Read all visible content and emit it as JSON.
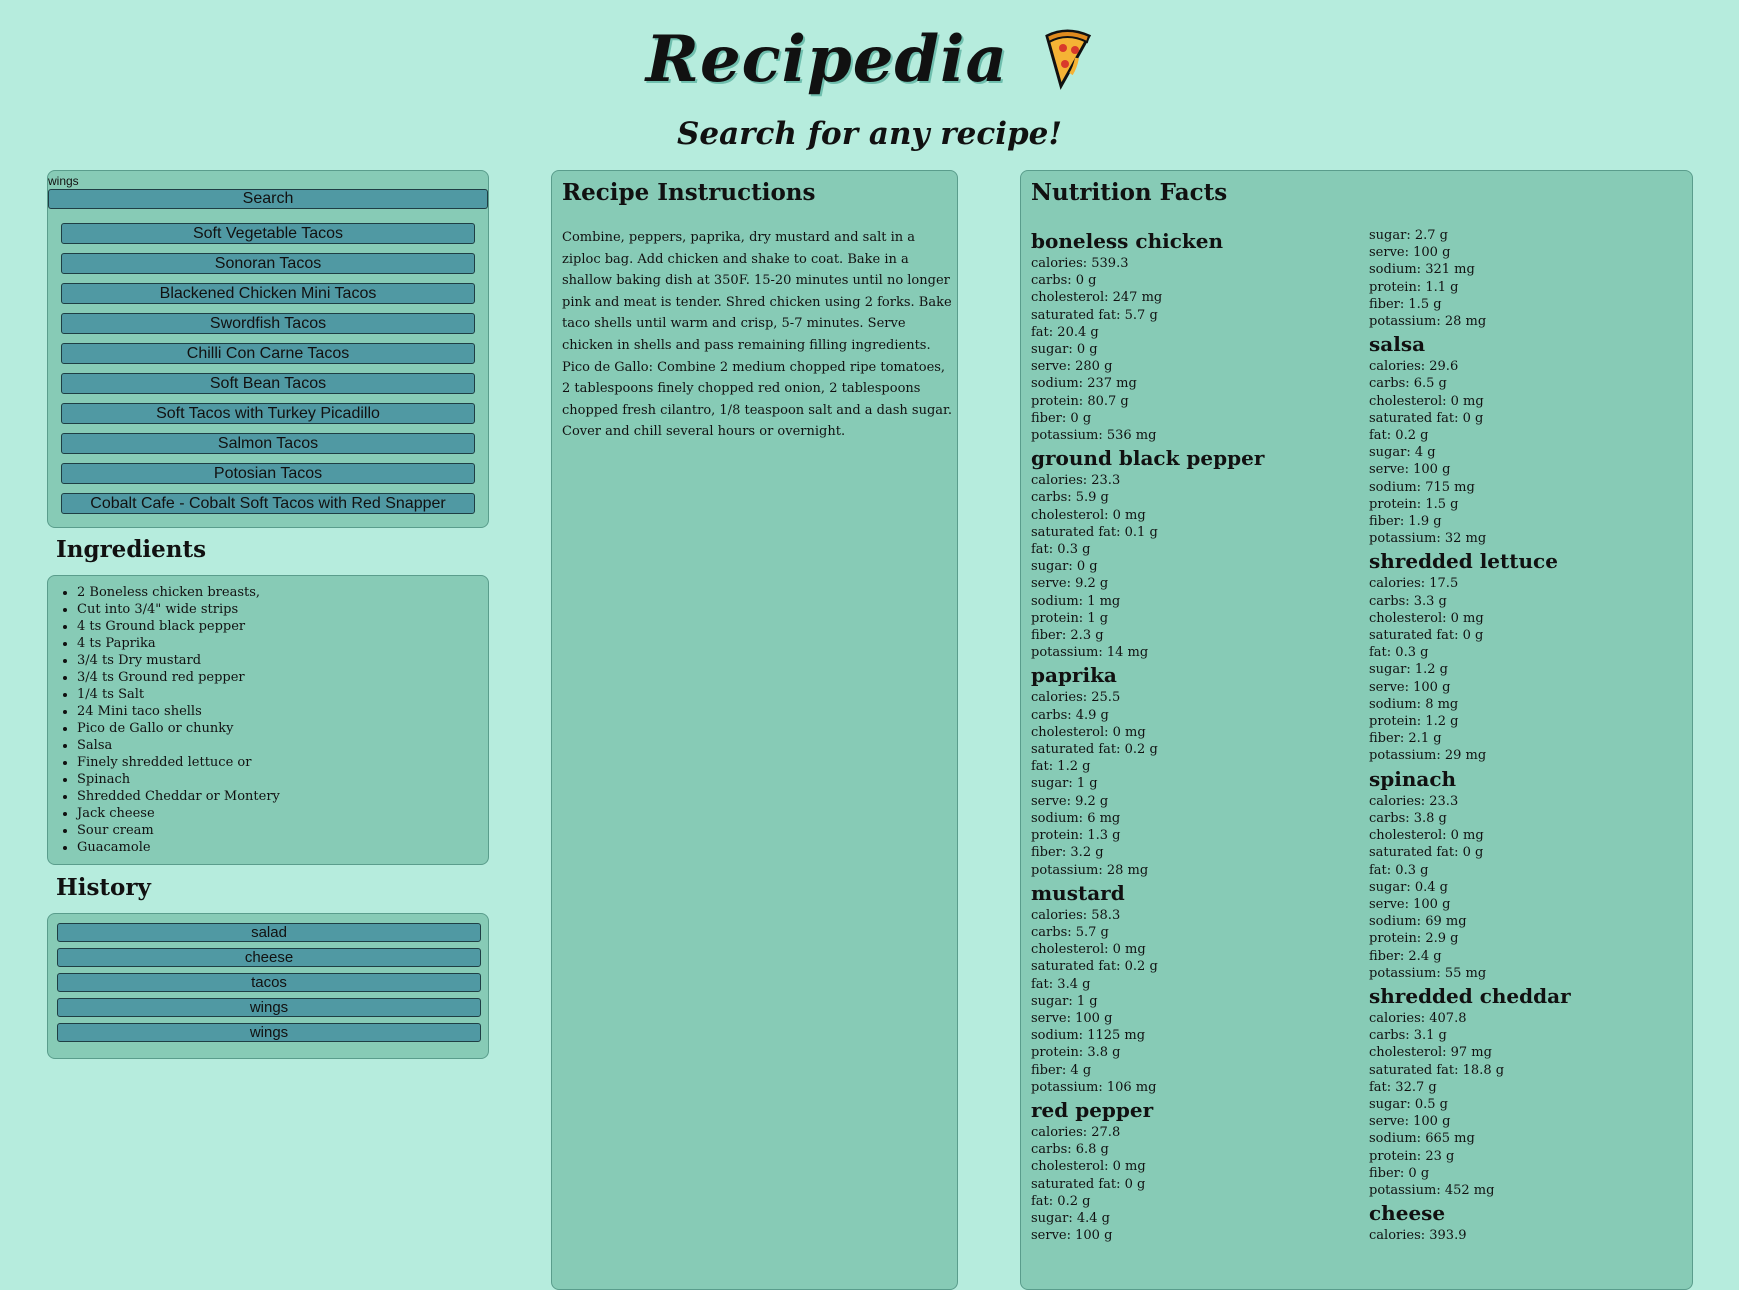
{
  "header": {
    "title": "Recipedia",
    "subtitle": "Search for any recipe!"
  },
  "search": {
    "value": "wings",
    "button_label": "Search",
    "results": [
      "Soft Vegetable Tacos",
      "Sonoran Tacos",
      "Blackened Chicken Mini Tacos",
      "Swordfish Tacos",
      "Chilli Con Carne Tacos",
      "Soft Bean Tacos",
      "Soft Tacos with Turkey Picadillo",
      "Salmon Tacos",
      "Potosian Tacos",
      "Cobalt Cafe - Cobalt Soft Tacos with Red Snapper"
    ]
  },
  "ingredients": {
    "heading": "Ingredients",
    "items": [
      "2 Boneless chicken breasts,",
      "Cut into 3/4\" wide strips",
      "4 ts Ground black pepper",
      "4 ts Paprika",
      "3/4 ts Dry mustard",
      "3/4 ts Ground red pepper",
      "1/4 ts Salt",
      "24 Mini taco shells",
      "Pico de Gallo or chunky",
      "Salsa",
      "Finely shredded lettuce or",
      "Spinach",
      "Shredded Cheddar or Montery",
      "Jack cheese",
      "Sour cream",
      "Guacamole"
    ]
  },
  "history": {
    "heading": "History",
    "items": [
      "salad",
      "cheese",
      "tacos",
      "wings",
      "wings"
    ]
  },
  "instructions": {
    "heading": "Recipe Instructions",
    "text": "Combine, peppers, paprika, dry mustard and salt in a ziploc bag. Add chicken and shake to coat. Bake in a shallow baking dish at 350F. 15-20 minutes until no longer pink and meat is tender. Shred chicken using 2 forks. Bake taco shells until warm and crisp, 5-7 minutes. Serve chicken in shells and pass remaining filling ingredients. Pico de Gallo: Combine 2 medium chopped ripe tomatoes, 2 tablespoons finely chopped red onion, 2 tablespoons chopped fresh cilantro, 1/8 teaspoon salt and a dash sugar. Cover and chill several hours or overnight."
  },
  "nutrition": {
    "heading": "Nutrition Facts",
    "col1": [
      {
        "name": "boneless chicken",
        "rows": [
          "calories: 539.3",
          "carbs: 0 g",
          "cholesterol: 247 mg",
          "saturated fat: 5.7 g",
          "fat: 20.4 g",
          "sugar: 0 g",
          "serve: 280 g",
          "sodium: 237 mg",
          "protein: 80.7 g",
          "fiber: 0 g",
          "potassium: 536 mg"
        ]
      },
      {
        "name": "ground black pepper",
        "rows": [
          "calories: 23.3",
          "carbs: 5.9 g",
          "cholesterol: 0 mg",
          "saturated fat: 0.1 g",
          "fat: 0.3 g",
          "sugar: 0 g",
          "serve: 9.2 g",
          "sodium: 1 mg",
          "protein: 1 g",
          "fiber: 2.3 g",
          "potassium: 14 mg"
        ]
      },
      {
        "name": "paprika",
        "rows": [
          "calories: 25.5",
          "carbs: 4.9 g",
          "cholesterol: 0 mg",
          "saturated fat: 0.2 g",
          "fat: 1.2 g",
          "sugar: 1 g",
          "serve: 9.2 g",
          "sodium: 6 mg",
          "protein: 1.3 g",
          "fiber: 3.2 g",
          "potassium: 28 mg"
        ]
      },
      {
        "name": "mustard",
        "rows": [
          "calories: 58.3",
          "carbs: 5.7 g",
          "cholesterol: 0 mg",
          "saturated fat: 0.2 g",
          "fat: 3.4 g",
          "sugar: 1 g",
          "serve: 100 g",
          "sodium: 1125 mg",
          "protein: 3.8 g",
          "fiber: 4 g",
          "potassium: 106 mg"
        ]
      },
      {
        "name": "red pepper",
        "rows": [
          "calories: 27.8",
          "carbs: 6.8 g",
          "cholesterol: 0 mg",
          "saturated fat: 0 g",
          "fat: 0.2 g",
          "sugar: 4.4 g",
          "serve: 100 g"
        ]
      }
    ],
    "col2_top_rows": [
      "sugar: 2.7 g",
      "serve: 100 g",
      "sodium: 321 mg",
      "protein: 1.1 g",
      "fiber: 1.5 g",
      "potassium: 28 mg"
    ],
    "col2": [
      {
        "name": "salsa",
        "rows": [
          "calories: 29.6",
          "carbs: 6.5 g",
          "cholesterol: 0 mg",
          "saturated fat: 0 g",
          "fat: 0.2 g",
          "sugar: 4 g",
          "serve: 100 g",
          "sodium: 715 mg",
          "protein: 1.5 g",
          "fiber: 1.9 g",
          "potassium: 32 mg"
        ]
      },
      {
        "name": "shredded lettuce",
        "rows": [
          "calories: 17.5",
          "carbs: 3.3 g",
          "cholesterol: 0 mg",
          "saturated fat: 0 g",
          "fat: 0.3 g",
          "sugar: 1.2 g",
          "serve: 100 g",
          "sodium: 8 mg",
          "protein: 1.2 g",
          "fiber: 2.1 g",
          "potassium: 29 mg"
        ]
      },
      {
        "name": "spinach",
        "rows": [
          "calories: 23.3",
          "carbs: 3.8 g",
          "cholesterol: 0 mg",
          "saturated fat: 0 g",
          "fat: 0.3 g",
          "sugar: 0.4 g",
          "serve: 100 g",
          "sodium: 69 mg",
          "protein: 2.9 g",
          "fiber: 2.4 g",
          "potassium: 55 mg"
        ]
      },
      {
        "name": "shredded cheddar",
        "rows": [
          "calories: 407.8",
          "carbs: 3.1 g",
          "cholesterol: 97 mg",
          "saturated fat: 18.8 g",
          "fat: 32.7 g",
          "sugar: 0.5 g",
          "serve: 100 g",
          "sodium: 665 mg",
          "protein: 23 g",
          "fiber: 0 g",
          "potassium: 452 mg"
        ]
      },
      {
        "name": "cheese",
        "rows": [
          "calories: 393.9"
        ]
      }
    ]
  }
}
